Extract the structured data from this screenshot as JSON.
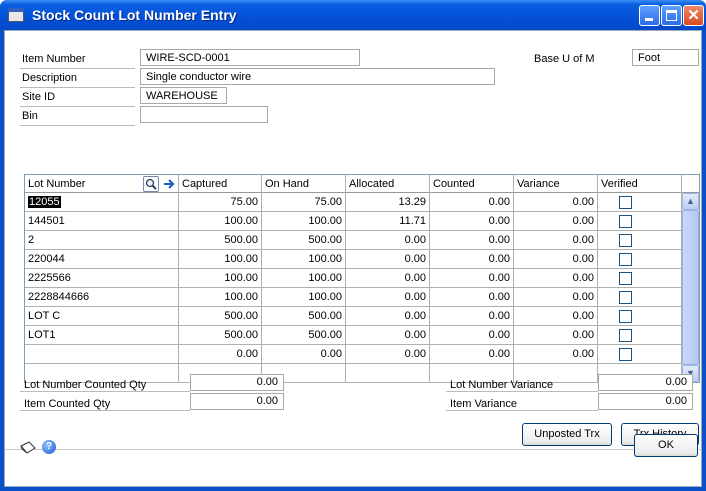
{
  "window": {
    "title": "Stock Count Lot Number Entry",
    "close_glyph": "✕"
  },
  "header": {
    "item_number_label": "Item Number",
    "item_number": "WIRE-SCD-0001",
    "description_label": "Description",
    "description": "Single conductor wire",
    "site_id_label": "Site ID",
    "site_id": "WAREHOUSE",
    "bin_label": "Bin",
    "bin": "",
    "base_uom_label": "Base U of M",
    "base_uom": "Foot"
  },
  "grid": {
    "columns": [
      "Lot Number",
      "Captured",
      "On Hand",
      "Allocated",
      "Counted",
      "Variance",
      "Verified"
    ],
    "rows": [
      {
        "lot": "12055",
        "captured": "75.00",
        "on_hand": "75.00",
        "allocated": "13.29",
        "counted": "0.00",
        "variance": "0.00"
      },
      {
        "lot": "144501",
        "captured": "100.00",
        "on_hand": "100.00",
        "allocated": "11.71",
        "counted": "0.00",
        "variance": "0.00"
      },
      {
        "lot": "2",
        "captured": "500.00",
        "on_hand": "500.00",
        "allocated": "0.00",
        "counted": "0.00",
        "variance": "0.00"
      },
      {
        "lot": "220044",
        "captured": "100.00",
        "on_hand": "100.00",
        "allocated": "0.00",
        "counted": "0.00",
        "variance": "0.00"
      },
      {
        "lot": "2225566",
        "captured": "100.00",
        "on_hand": "100.00",
        "allocated": "0.00",
        "counted": "0.00",
        "variance": "0.00"
      },
      {
        "lot": "2228844666",
        "captured": "100.00",
        "on_hand": "100.00",
        "allocated": "0.00",
        "counted": "0.00",
        "variance": "0.00"
      },
      {
        "lot": "LOT C",
        "captured": "500.00",
        "on_hand": "500.00",
        "allocated": "0.00",
        "counted": "0.00",
        "variance": "0.00"
      },
      {
        "lot": "LOT1",
        "captured": "500.00",
        "on_hand": "500.00",
        "allocated": "0.00",
        "counted": "0.00",
        "variance": "0.00"
      },
      {
        "lot": "",
        "captured": "0.00",
        "on_hand": "0.00",
        "allocated": "0.00",
        "counted": "0.00",
        "variance": "0.00"
      }
    ]
  },
  "summary": {
    "lot_counted_label": "Lot Number Counted Qty",
    "lot_counted": "0.00",
    "item_counted_label": "Item Counted Qty",
    "item_counted": "0.00",
    "lot_variance_label": "Lot Number Variance",
    "lot_variance": "0.00",
    "item_variance_label": "Item Variance",
    "item_variance": "0.00"
  },
  "buttons": {
    "unposted": "Unposted Trx",
    "history": "Trx History",
    "ok": "OK"
  },
  "icons": {
    "lookup": "magnifier-icon",
    "expand": "arrow-right-icon",
    "note": "note-icon",
    "help": "help-icon"
  },
  "colors": {
    "titlebar": "#0450d8",
    "selection": "#000000"
  }
}
